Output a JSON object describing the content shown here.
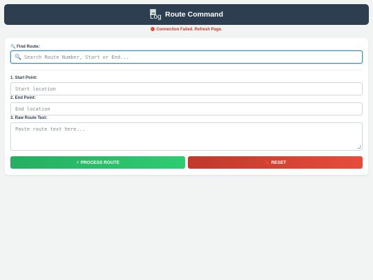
{
  "header": {
    "logo_alt": "Logo",
    "title": "Route Command"
  },
  "status": {
    "message": "Connection Failed. Refresh Page.",
    "color": "#e74c3c"
  },
  "search": {
    "label": "🔍 Find Route:",
    "icon": "magnifier-icon",
    "placeholder": "Search Route Number, Start or End..."
  },
  "form": {
    "start_label": "1. Start Point:",
    "start_placeholder": "Start location",
    "end_label": "2. End Point:",
    "end_placeholder": "End location",
    "raw_label": "3. Raw Route Text:",
    "raw_placeholder": "Paste route text here..."
  },
  "actions": {
    "process_label": "⚡ PROCESS ROUTE",
    "reset_label": "❌ RESET"
  },
  "colors": {
    "header": "#2c3e50",
    "process": "#2ecc71",
    "reset": "#e74c3c",
    "focus": "#3a8fb7"
  }
}
